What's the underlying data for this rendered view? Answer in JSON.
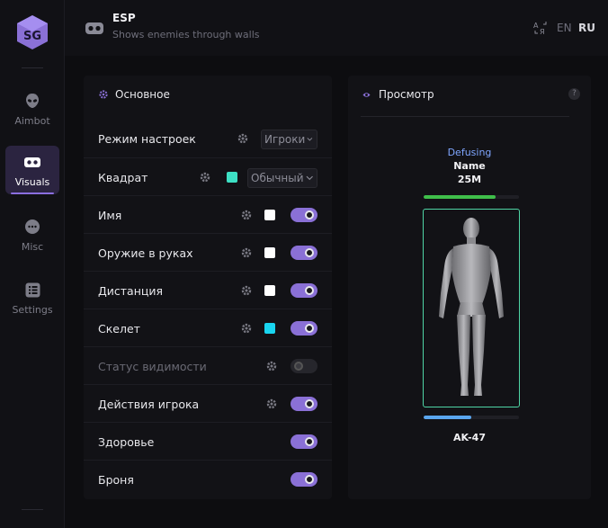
{
  "header": {
    "title": "ESP",
    "subtitle": "Shows enemies through walls",
    "lang_en": "EN",
    "lang_ru": "RU"
  },
  "sidebar": {
    "items": [
      {
        "label": "Aimbot",
        "icon": "alien-icon"
      },
      {
        "label": "Visuals",
        "icon": "goggles-icon",
        "active": true
      },
      {
        "label": "Misc",
        "icon": "more-dots-icon"
      },
      {
        "label": "Settings",
        "icon": "list-icon"
      }
    ]
  },
  "main_panel": {
    "title": "Основное",
    "rows": [
      {
        "label": "Режим настроек",
        "select": "Игроки"
      },
      {
        "label": "Квадрат",
        "select": "Обычный",
        "color": "#3de0c4"
      },
      {
        "label": "Имя",
        "color": "#ffffff",
        "toggle": true
      },
      {
        "label": "Оружие в руках",
        "color": "#ffffff",
        "toggle": true
      },
      {
        "label": "Дистанция",
        "color": "#ffffff",
        "toggle": true
      },
      {
        "label": "Скелет",
        "color": "#19d5f0",
        "toggle": true
      },
      {
        "label": "Статус видимости",
        "toggle": false,
        "disabled": true
      },
      {
        "label": "Действия игрока",
        "toggle": true
      },
      {
        "label": "Здоровье",
        "toggle": true
      },
      {
        "label": "Броня",
        "toggle": true
      }
    ]
  },
  "preview": {
    "title": "Просмотр",
    "help": "?",
    "status": "Defusing",
    "name": "Name",
    "distance": "25M",
    "health_fraction": 0.75,
    "armor_fraction": 0.5,
    "weapon": "AK-47"
  },
  "colors": {
    "accent": "#8a70d6",
    "box": "#4fd5a5",
    "health": "#3fbf4a",
    "armor": "#5aa6ee",
    "status": "#7fa6ff"
  }
}
